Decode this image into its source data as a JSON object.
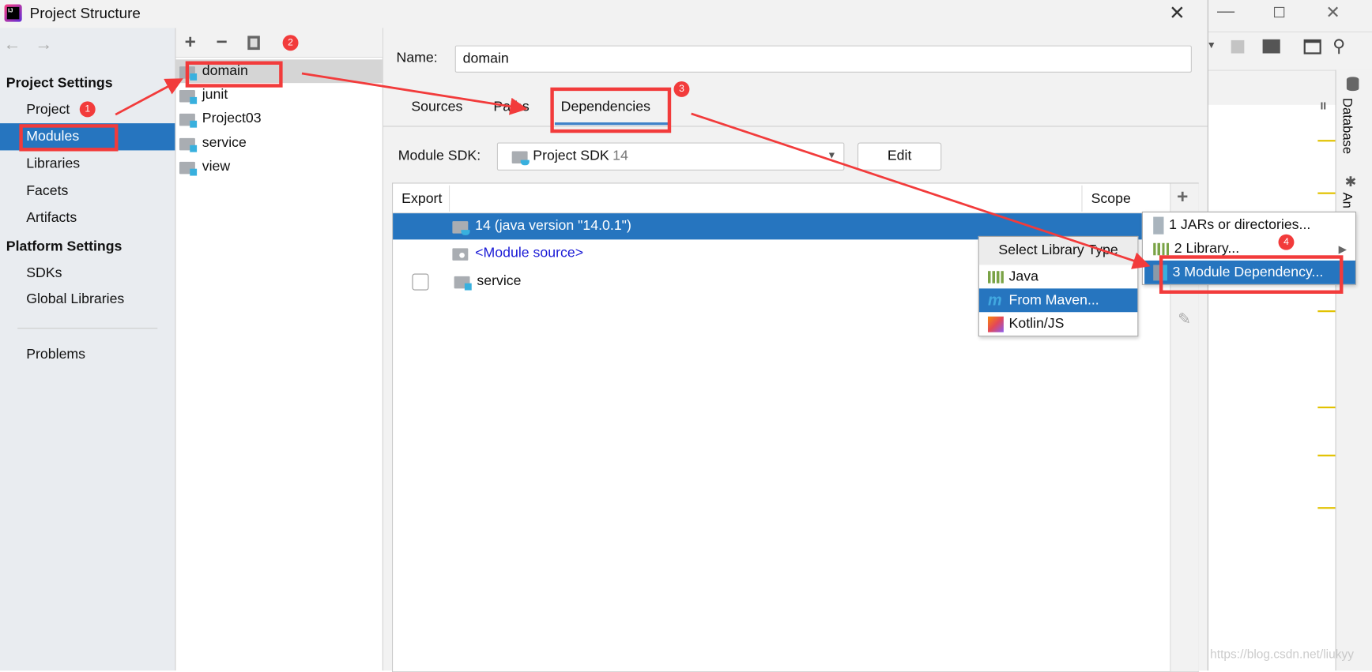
{
  "window": {
    "title": "Project Structure"
  },
  "sidebar": {
    "sections": [
      {
        "title": "Project Settings",
        "items": [
          "Project",
          "Modules",
          "Libraries",
          "Facets",
          "Artifacts"
        ]
      },
      {
        "title": "Platform Settings",
        "items": [
          "SDKs",
          "Global Libraries"
        ]
      }
    ],
    "problems": "Problems",
    "selected": "Modules"
  },
  "modules": {
    "items": [
      "domain",
      "junit",
      "Project03",
      "service",
      "view"
    ],
    "selected": "domain"
  },
  "main": {
    "name_label": "Name:",
    "name_value": "domain",
    "tabs": [
      "Sources",
      "Paths",
      "Dependencies"
    ],
    "active_tab": "Dependencies",
    "sdk_label": "Module SDK:",
    "sdk_value": "Project SDK",
    "sdk_version": "14",
    "edit": "Edit",
    "table": {
      "col_export": "Export",
      "col_scope": "Scope",
      "rows": [
        {
          "name": "14 (java version \"14.0.1\")"
        },
        {
          "name": "<Module source>"
        },
        {
          "name": "service"
        }
      ]
    }
  },
  "popup_add": {
    "items": [
      "1  JARs or directories...",
      "2  Library...",
      "3  Module Dependency..."
    ],
    "selected": "3  Module Dependency..."
  },
  "popup_library": {
    "header": "Select Library Type",
    "items": [
      "Java",
      "From Maven...",
      "Kotlin/JS"
    ],
    "selected": "From Maven..."
  },
  "annotations": [
    "1",
    "2",
    "3",
    "4"
  ],
  "ide": {
    "side_tabs": [
      "Database",
      "An"
    ]
  },
  "watermark": "https://blog.csdn.net/liukyy",
  "colors": {
    "selection": "#2675bf",
    "annotation": "#f23b3b",
    "link": "#1a1ad6"
  }
}
